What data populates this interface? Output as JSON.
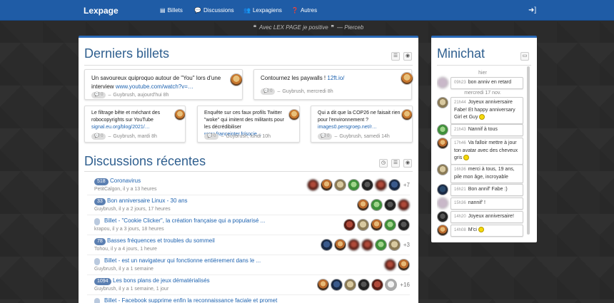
{
  "navbar": {
    "brand": "Lexpage",
    "items": [
      {
        "label": "Billets",
        "icon": "file-icon"
      },
      {
        "label": "Discussions",
        "icon": "comments-icon"
      },
      {
        "label": "Lexpagiens",
        "icon": "users-icon"
      },
      {
        "label": "Autres",
        "icon": "question-icon"
      }
    ],
    "login_icon": "sign-in-icon"
  },
  "quote": {
    "text": "Avec LEX PAGE je positive",
    "author": "Pierceb"
  },
  "billets": {
    "heading": "Derniers billets",
    "cards": [
      {
        "title": "Un savoureux quiproquo autour de \"You\" lors d'une interview",
        "link": "www.youtube.com/watch?v=…",
        "count": "0",
        "meta": "Guybrush, aujourd'hui 8h"
      },
      {
        "title": "Contournez les paywalls !",
        "link": "12ft.io/",
        "count": "0",
        "meta": "Guybrush, mercredi 8h"
      },
      {
        "title": "Le filtrage bête et méchant des robocopyrights sur YouTube",
        "link": "signal.eu.org/blog/2021/…",
        "count": "0",
        "meta": "Guybrush, mardi 8h"
      },
      {
        "title": "Enquête sur ces faux profils Twitter \"woke\" qui imitent des militants pour les décrédibiliser",
        "link": "www.franceinter.fr/socie…",
        "count": "0",
        "meta": "Guybrush, lundi 10h"
      },
      {
        "title": "Qui a dit que la COP26 ne faisait rien pour l'environnement ?",
        "link": "images0.persgroep.net/r…",
        "count": "0",
        "meta": "Guybrush, samedi 14h"
      }
    ]
  },
  "discussions": {
    "heading": "Discussions récentes",
    "rows": [
      {
        "badge": "518",
        "title": "Coronavirus",
        "meta": "PetitCalgon, il y a 13 heures",
        "more": "+7"
      },
      {
        "badge": "33",
        "title": "Bon anniversaire Linux - 30 ans",
        "meta": "Guybrush, il y a 2 jours, 17 heures",
        "more": ""
      },
      {
        "badge": "",
        "title": "Billet - \"Cookie Clicker\", la création française qui a popularisé ...",
        "meta": "krapou, il y a 3 jours, 18 heures",
        "more": ""
      },
      {
        "badge": "78",
        "title": "Basses fréquences et troubles du sommeil",
        "meta": "Tohou, il y a 4 jours, 1 heure",
        "more": "+3"
      },
      {
        "badge": "",
        "title": "Billet - est un navigateur qui fonctionne entièrement dans le ...",
        "meta": "Guybrush, il y a 1 semaine",
        "more": ""
      },
      {
        "badge": "1094",
        "title": "Les bons plans de jeux dématérialisés",
        "meta": "Guybrush, il y a 1 semaine, 1 jour",
        "more": "+16"
      },
      {
        "badge": "",
        "title": "Billet - Facebook supprime enfin la reconnaissance faciale et promet",
        "meta": "",
        "more": ""
      }
    ]
  },
  "minichat": {
    "heading": "Minichat",
    "days": [
      "hier",
      "mercredi 17 nov."
    ],
    "messages": [
      {
        "time": "09h23",
        "text": "bon anniv en retard"
      },
      {
        "time": "21h44",
        "text": "Joyeux anniversaire Fabe! Et happy anniversary Girl et Guy"
      },
      {
        "time": "21h43",
        "text": "Nannif à tous"
      },
      {
        "time": "17h46",
        "text": "Va falloir mettre à jour ton avatar avec des cheveux gris"
      },
      {
        "time": "16h36",
        "text": "merci à tous, 19 ans, pile mon âge, incroyable"
      },
      {
        "time": "16h21",
        "text": "Bon annif' Fabe :)"
      },
      {
        "time": "15h36",
        "text": "nannif' !"
      },
      {
        "time": "14h20",
        "text": "Joyeux anniversaire!"
      },
      {
        "time": "14h08",
        "text": "M'ci"
      }
    ]
  }
}
